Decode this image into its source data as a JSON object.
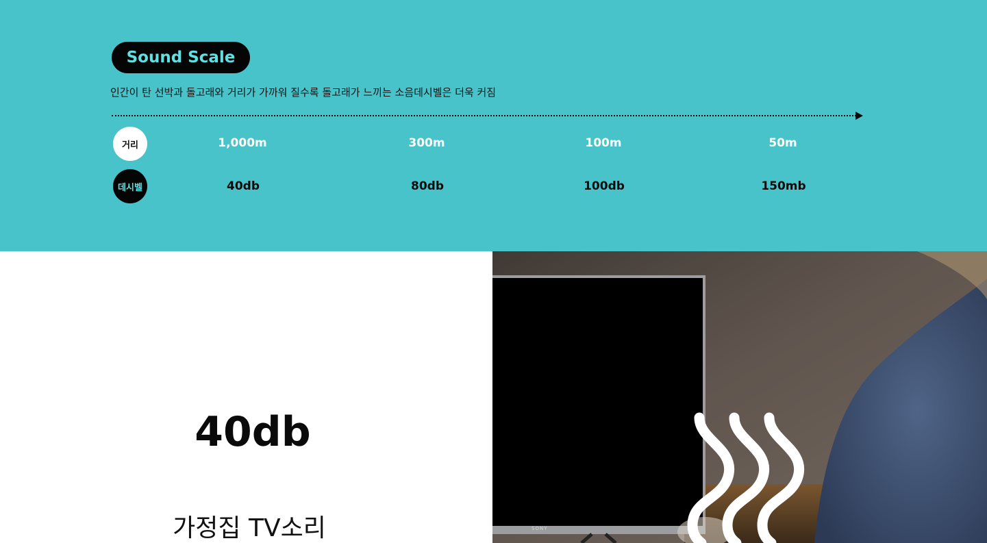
{
  "header": {
    "badge_label": "Sound Scale",
    "subtitle": "인간이 탄 선박과 돌고래와 거리가 가까워 질수록 돌고래가 느끼는 소음데시벨은 더욱 커짐"
  },
  "scale": {
    "distance_label": "거리",
    "decibel_label": "데시벨",
    "distances": [
      "1,000m",
      "300m",
      "100m",
      "50m"
    ],
    "decibels": [
      "40db",
      "80db",
      "100db",
      "150mb"
    ]
  },
  "feature": {
    "level": "40db",
    "caption": "가정집 TV소리"
  },
  "photo": {
    "tv_brand": "SONY",
    "icon": "sound-waves-icon"
  },
  "colors": {
    "accent": "#49c3ca",
    "badge_text": "#5fe0e2",
    "dark": "#050505"
  }
}
